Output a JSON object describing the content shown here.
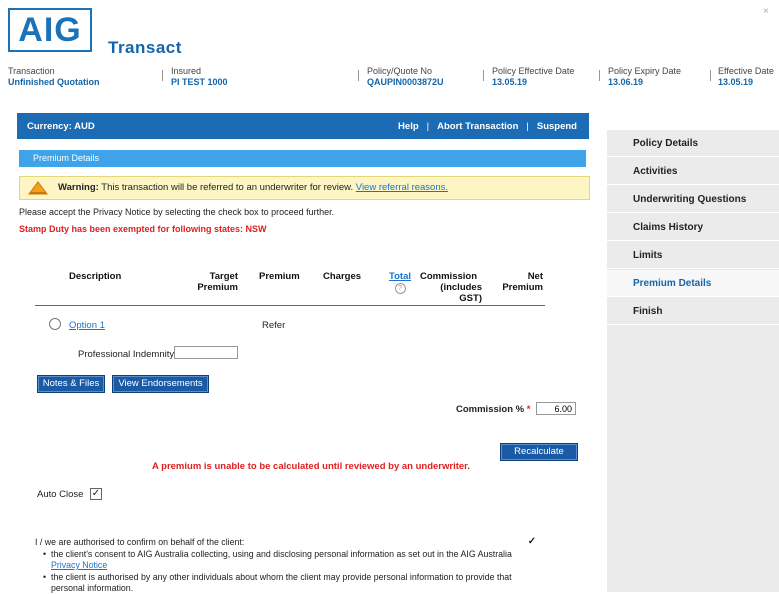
{
  "header": {
    "logo_text": "AIG",
    "brand": "Transact",
    "close_glyph": "×",
    "fields": [
      {
        "label": "Transaction",
        "value": "Unfinished Quotation"
      },
      {
        "label": "Insured",
        "value": "PI TEST 1000"
      },
      {
        "label": "Policy/Quote No",
        "value": "QAUPIN0003872U"
      },
      {
        "label": "Policy Effective Date",
        "value": "13.05.19"
      },
      {
        "label": "Policy Expiry Date",
        "value": "13.06.19"
      },
      {
        "label": "Effective Date",
        "value": "13.05.19"
      }
    ]
  },
  "toolbar": {
    "currency": "Currency: AUD",
    "help": "Help",
    "abort": "Abort Transaction",
    "suspend": "Suspend",
    "pipe": "|"
  },
  "section_title": "Premium Details",
  "warning": {
    "bold": "Warning:",
    "text": " This transaction will be referred to an underwriter for review. ",
    "link": "View referral reasons."
  },
  "privacy_message": "Please accept the Privacy Notice by selecting the check box to proceed further.",
  "stamp_duty": "Stamp Duty has been exempted for following states: NSW",
  "table": {
    "headers": {
      "description": "Description",
      "target_premium_1": "Target",
      "target_premium_2": "Premium",
      "premium": "Premium",
      "charges": "Charges",
      "total": "Total",
      "help_glyph": "?",
      "commission_1": "Commission",
      "commission_2": "(includes",
      "commission_3": "GST)",
      "net_1": "Net",
      "net_2": "Premium"
    },
    "option_label": "Option 1",
    "option_premium": "Refer",
    "prof_indemnity_label": "Professional Indemnity",
    "prof_indemnity_value": ""
  },
  "buttons": {
    "notes_files": "Notes & Files",
    "view_endorsements": "View Endorsements",
    "recalculate": "Recalculate"
  },
  "commission": {
    "label": "Commission %",
    "required": "*",
    "value": "6.00"
  },
  "underwriter_message": "A premium is unable to be calculated until reviewed by an underwriter.",
  "auto_close": {
    "label": "Auto Close",
    "checked_glyph": "✓"
  },
  "authorisation": {
    "intro": "I / we are authorised to confirm on behalf of the client:",
    "bullet1_a": "the client's consent to AIG Australia collecting, using and disclosing personal information as set out in the AIG Australia ",
    "bullet1_link": "Privacy Notice",
    "bullet2": "the client is authorised by any other individuals about whom the client may provide personal information to provide that personal information.",
    "checked_glyph": "✓"
  },
  "sidebar": {
    "items": [
      {
        "label": "Policy Details"
      },
      {
        "label": "Activities"
      },
      {
        "label": "Underwriting Questions"
      },
      {
        "label": "Claims History"
      },
      {
        "label": "Limits"
      },
      {
        "label": "Premium Details"
      },
      {
        "label": "Finish"
      }
    ],
    "active_index": 5
  },
  "colors": {
    "primary": "#1b6cb5",
    "accent": "#3ea3e8",
    "warning_bg": "#fdf6c4",
    "error": "#e02020"
  }
}
